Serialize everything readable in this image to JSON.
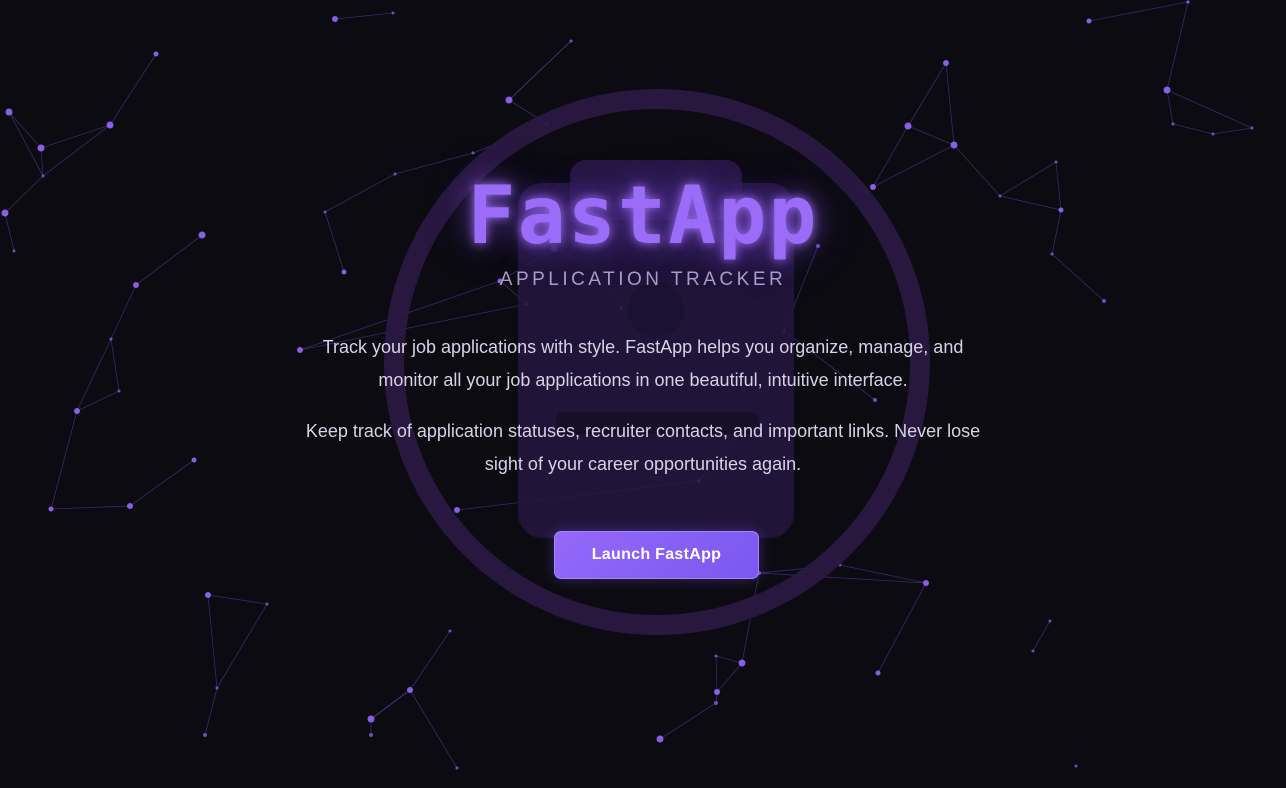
{
  "hero": {
    "title": "FastApp",
    "subtitle": "APPLICATION TRACKER",
    "intro_paragraph_1": "Track your job applications with style. FastApp helps you organize, manage, and monitor all your job applications in one beautiful, intuitive interface.",
    "intro_paragraph_2": "Keep track of application statuses, recruiter contacts, and important links. Never lose sight of your career opportunities again.",
    "cta_label": "Launch FastApp"
  },
  "background": {
    "emblem_icon": "clipboard-in-circle-icon",
    "pattern": "particle-network"
  },
  "colors": {
    "background": "#0c0b11",
    "accent": "#8b5cf6",
    "title_glow": "#9a6cf7",
    "subtitle": "#a79cc9",
    "body_text": "#d6d2e6",
    "button_text": "#ffffff"
  }
}
